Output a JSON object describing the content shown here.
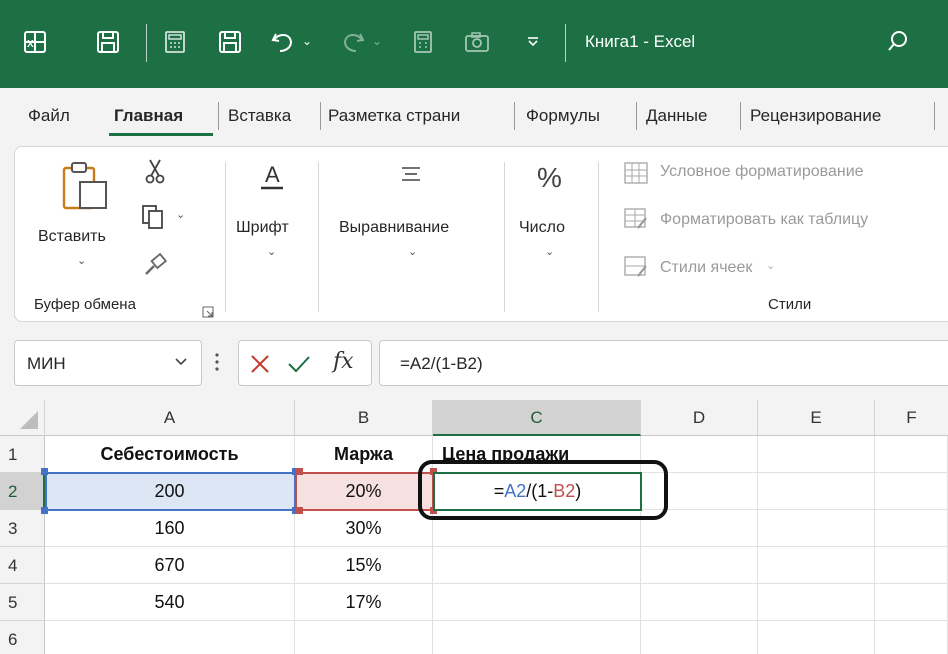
{
  "window": {
    "title": "Книга1  -  Excel",
    "brand_color": "#1d7044"
  },
  "quick_access": {
    "icons": [
      "excel-logo-icon",
      "save-icon",
      "calculator-icon",
      "save-icon",
      "undo-icon",
      "redo-icon",
      "calculator-icon",
      "camera-icon",
      "customize-icon",
      "search-icon"
    ]
  },
  "tabs": [
    "Файл",
    "Главная",
    "Вставка",
    "Разметка страни",
    "Формулы",
    "Данные",
    "Рецензирование"
  ],
  "ribbon": {
    "paste_label": "Вставить",
    "clipboard_group": "Буфер обмена",
    "font_label": "Шрифт",
    "align_label": "Выравнивание",
    "number_label": "Число",
    "cond_format": "Условное форматирование",
    "format_table": "Форматировать как таблицу",
    "cell_styles": "Стили ячеек",
    "styles_group": "Стили"
  },
  "formula_bar": {
    "name_box": "МИН",
    "formula": "=A2/(1-B2)",
    "fx": "fx"
  },
  "grid": {
    "columns": [
      "A",
      "B",
      "C",
      "D",
      "E",
      "F"
    ],
    "rows": [
      "1",
      "2",
      "3",
      "4",
      "5",
      "6"
    ],
    "header_row": [
      "Себестоимость",
      "Маржа",
      "Цена продажи"
    ],
    "data": [
      [
        "200",
        "20%"
      ],
      [
        "160",
        "30%"
      ],
      [
        "670",
        "15%"
      ],
      [
        "540",
        "17%"
      ]
    ],
    "editing_cell": {
      "eq": "=",
      "ref1": "A2",
      "mid": "/(1-",
      "ref2": "B2",
      "end": ")"
    },
    "ref_colors": {
      "a2": "#4472c4",
      "b2": "#c0504d"
    }
  }
}
